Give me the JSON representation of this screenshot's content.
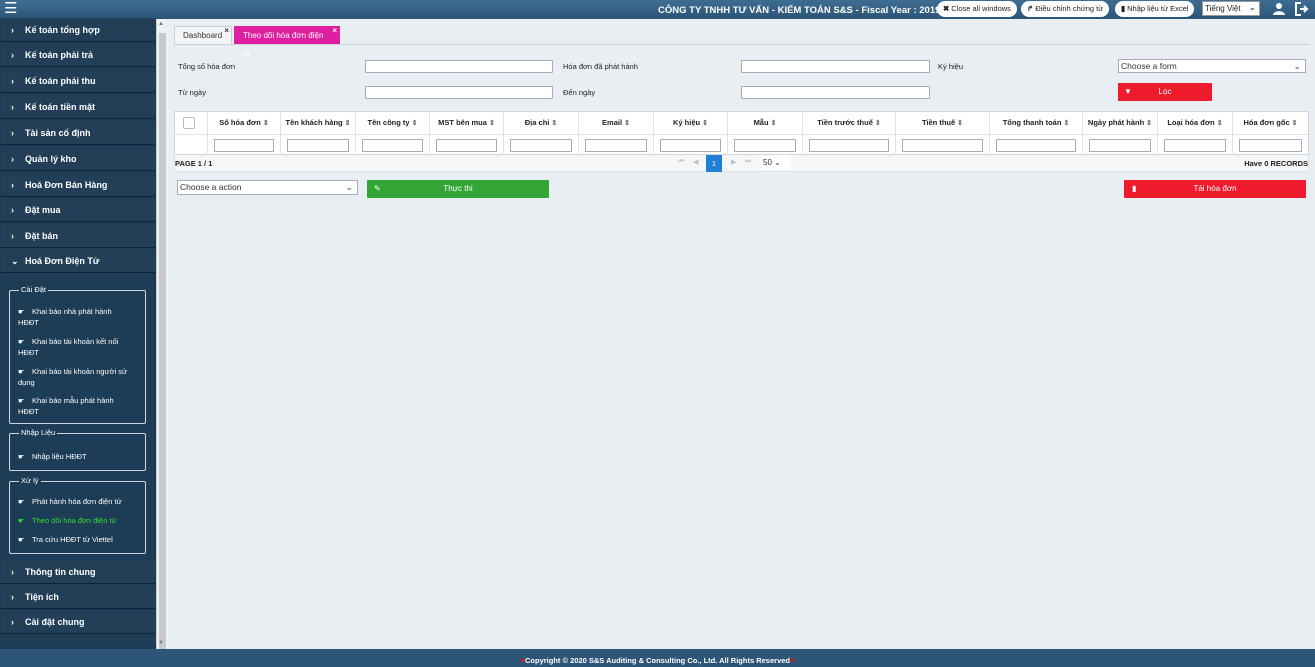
{
  "header": {
    "company": "CÔNG TY TNHH TƯ VẤN - KIỂM TOÁN S&S - Fiscal Year : 2019",
    "close_all": "Close all windows",
    "adjust": "Điều chỉnh chứng từ",
    "import_excel": "Nhập liệu từ Excel",
    "language": "Tiếng Việt"
  },
  "sidebar": {
    "items_top": [
      "Kế toán tổng hợp",
      "Kế toán phải trả",
      "Kế toán phải thu",
      "Kế toán tiền mặt",
      "Tài sản cố định",
      "Quản lý kho",
      "Hoá Đơn Bán Hàng",
      "Đặt mua",
      "Đặt bán",
      "Hoá Đơn Điện Tử"
    ],
    "groups": [
      {
        "title": "Cài Đặt",
        "items": [
          [
            "Khai báo nhà phát hành",
            "HĐĐT"
          ],
          [
            "Khai báo tài khoản kết nối",
            "HĐĐT"
          ],
          [
            "Khai báo tài khoản người sử",
            "dụng"
          ],
          [
            "Khai báo mẫu phát hành",
            "HĐĐT"
          ]
        ]
      },
      {
        "title": "Nhập Liệu",
        "items": [
          [
            "Nhập liệu HĐĐT",
            ""
          ]
        ]
      },
      {
        "title": "Xử lý",
        "items": [
          [
            "Phát hành hóa đơn điện tử",
            ""
          ],
          [
            "Theo dõi hóa đơn điện tử",
            ""
          ],
          [
            "Tra cứu HĐĐT từ Viettel",
            ""
          ]
        ]
      }
    ],
    "items_bottom": [
      "Thông tin chung",
      "Tiện ích",
      "Cài đặt chung"
    ]
  },
  "tabs": {
    "dashboard": "Dashboard",
    "current": "Theo dõi hóa đơn điện tử"
  },
  "filters": {
    "total_label": "Tổng số hóa đơn",
    "issued_label": "Hóa đơn đã phát hành",
    "symbol_label": "Ký hiệu",
    "from_label": "Từ ngày",
    "to_label": "Đến ngày",
    "form_select": "Choose a form",
    "filter_button": "Lọc"
  },
  "table": {
    "columns": [
      "Số hóa đơn",
      "Tên khách hàng",
      "Tên công ty",
      "MST bên mua",
      "Địa chỉ",
      "Email",
      "Ký hiệu",
      "Mẫu",
      "Tiền trước thuế",
      "Tiền thuế",
      "Tổng thanh toán",
      "Ngày phát hành",
      "Loại hóa đơn",
      "Hóa đơn gốc"
    ],
    "page_info": "PAGE 1 / 1",
    "current_page": "1",
    "page_size": "50",
    "records": "Have 0 RECORDS"
  },
  "actions": {
    "action_select": "Choose a action",
    "execute": "Thực thi",
    "download": "Tải hóa đơn"
  },
  "footer": {
    "copyright": "Copyright © 2020 S&S Auditing & Consulting Co., Ltd. All Rights Reserved"
  },
  "colors": {
    "header": "#2c5577",
    "sidebar": "#1d3c56",
    "active_tab": "#e01fa0",
    "red_button": "#ee1b2d",
    "green_button": "#33a535",
    "active_link": "#2fe02f"
  }
}
